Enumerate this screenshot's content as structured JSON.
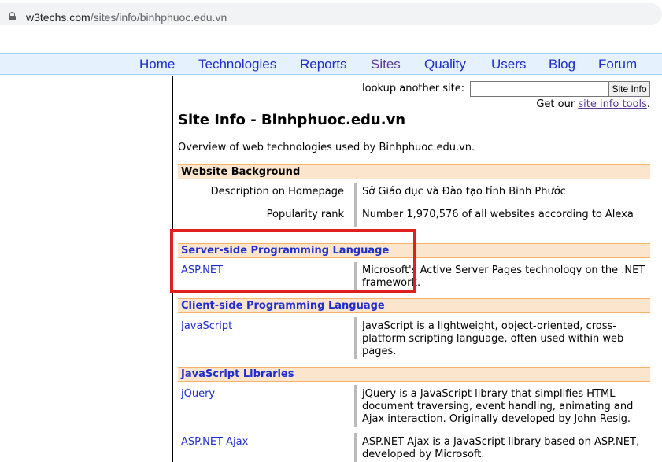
{
  "browser": {
    "url_domain": "w3techs.com",
    "url_path": "/sites/info/binhphuoc.edu.vn"
  },
  "nav": {
    "items": [
      {
        "label": "Home",
        "visited": false
      },
      {
        "label": "Technologies",
        "visited": false
      },
      {
        "label": "Reports",
        "visited": false
      },
      {
        "label": "Sites",
        "visited": true
      },
      {
        "label": "Quality",
        "visited": false
      },
      {
        "label": "Users",
        "visited": false
      },
      {
        "label": "Blog",
        "visited": false
      },
      {
        "label": "Forum",
        "visited": false
      }
    ]
  },
  "lookup": {
    "label": "lookup another site:",
    "input_value": "",
    "button_label": "Site Info",
    "tools_prefix": "Get our ",
    "tools_link": "site info tools",
    "tools_suffix": "."
  },
  "page": {
    "title": "Site Info - Binhphuoc.edu.vn",
    "overview": "Overview of web technologies used by Binhphuoc.edu.vn."
  },
  "sections": {
    "website_background": {
      "title": "Website Background",
      "rows": [
        {
          "label": "Description on Homepage",
          "value": "Sở Giáo dục và Đào tạo tỉnh Bình Phước"
        },
        {
          "label": "Popularity rank",
          "value": "Number 1,970,576 of all websites according to Alexa"
        }
      ]
    },
    "server_side": {
      "title": "Server-side Programming Language",
      "items": [
        {
          "name": "ASP.NET",
          "description": "Microsoft's Active Server Pages technology on the .NET framework."
        }
      ]
    },
    "client_side": {
      "title": "Client-side Programming Language",
      "items": [
        {
          "name": "JavaScript",
          "description": "JavaScript is a lightweight, object-oriented, cross-platform scripting language, often used within web pages."
        }
      ]
    },
    "js_libraries": {
      "title": "JavaScript Libraries",
      "items": [
        {
          "name": "jQuery",
          "description": "jQuery is a JavaScript library that simplifies HTML document traversing, event handling, animating and Ajax interaction. Originally developed by John Resig."
        },
        {
          "name": "ASP.NET Ajax",
          "description": "ASP.NET Ajax is a JavaScript library based on ASP.NET, developed by Microsoft."
        }
      ]
    }
  },
  "colors": {
    "link": "#1f2ecf",
    "visited_link": "#5d3a99",
    "section_header_bg": "#fce5cd",
    "nav_bg": "#e5f1fc",
    "highlight_box": "#e0201f"
  }
}
